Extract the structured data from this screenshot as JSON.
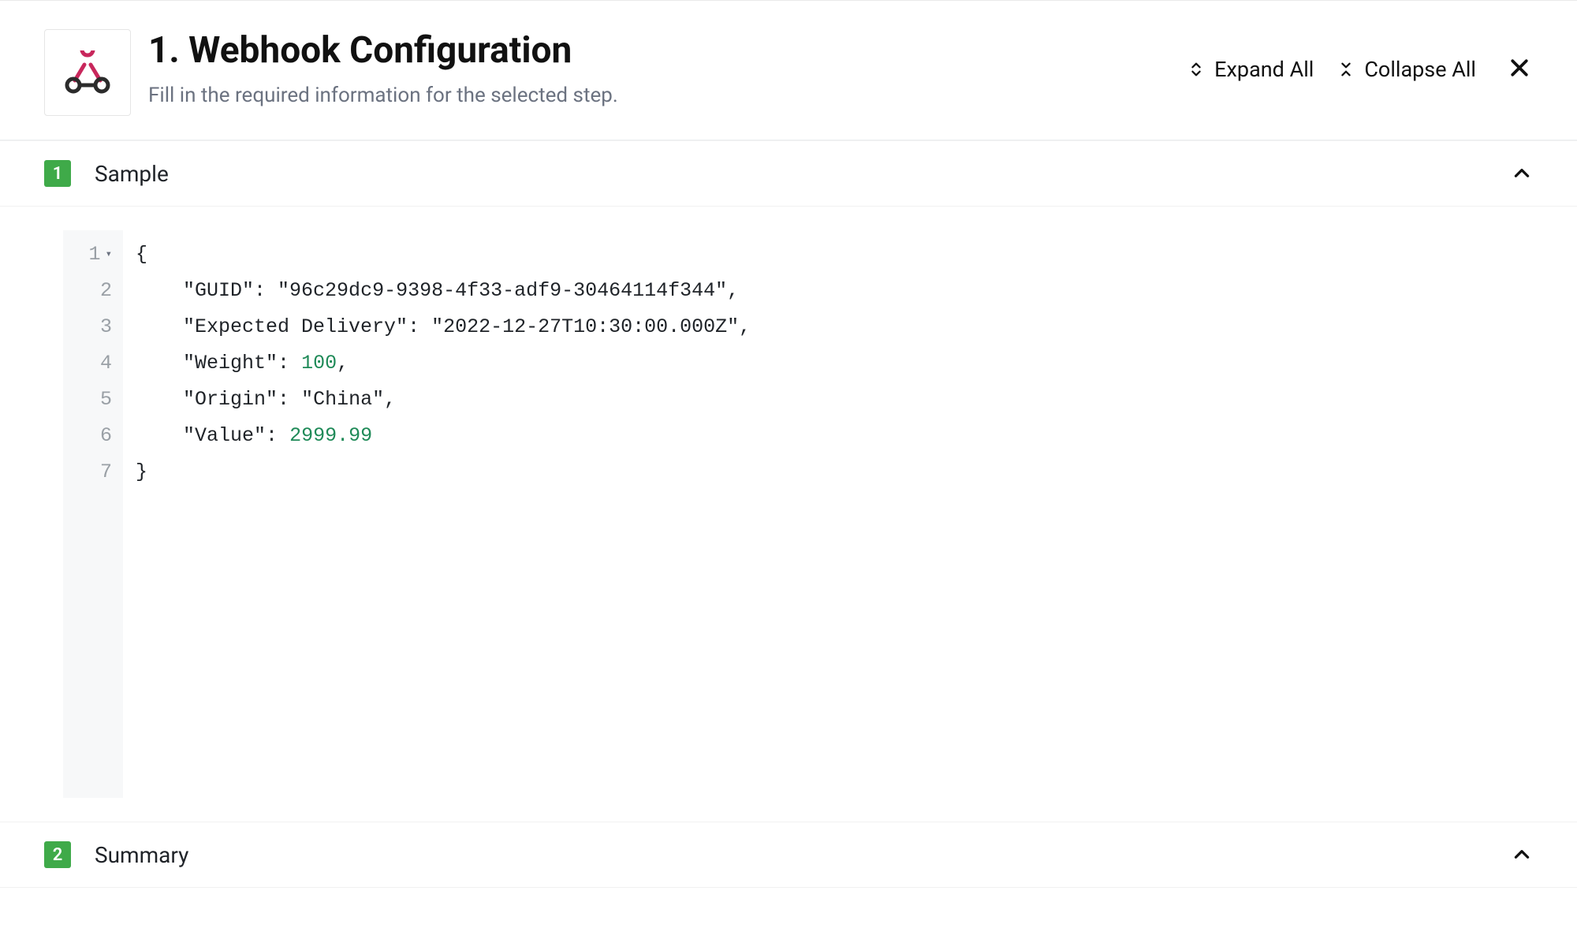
{
  "header": {
    "title": "1. Webhook Configuration",
    "subtitle": "Fill in the required information for the selected step.",
    "expand_label": "Expand All",
    "collapse_label": "Collapse All"
  },
  "sections": [
    {
      "num": "1",
      "title": "Sample"
    },
    {
      "num": "2",
      "title": "Summary"
    }
  ],
  "code_lines": [
    {
      "n": "1",
      "fold": true,
      "tokens": [
        {
          "t": "{",
          "cls": "punct"
        }
      ]
    },
    {
      "n": "2",
      "tokens": [
        {
          "t": "    ",
          "cls": "plain"
        },
        {
          "t": "\"GUID\"",
          "cls": "key"
        },
        {
          "t": ": ",
          "cls": "punct"
        },
        {
          "t": "\"96c29dc9-9398-4f33-adf9-30464114f344\"",
          "cls": "str"
        },
        {
          "t": ",",
          "cls": "punct"
        }
      ]
    },
    {
      "n": "3",
      "tokens": [
        {
          "t": "    ",
          "cls": "plain"
        },
        {
          "t": "\"Expected Delivery\"",
          "cls": "key"
        },
        {
          "t": ": ",
          "cls": "punct"
        },
        {
          "t": "\"2022-12-27T10:30:00.000Z\"",
          "cls": "str"
        },
        {
          "t": ",",
          "cls": "punct"
        }
      ]
    },
    {
      "n": "4",
      "tokens": [
        {
          "t": "    ",
          "cls": "plain"
        },
        {
          "t": "\"Weight\"",
          "cls": "key"
        },
        {
          "t": ": ",
          "cls": "punct"
        },
        {
          "t": "100",
          "cls": "num"
        },
        {
          "t": ",",
          "cls": "punct"
        }
      ]
    },
    {
      "n": "5",
      "tokens": [
        {
          "t": "    ",
          "cls": "plain"
        },
        {
          "t": "\"Origin\"",
          "cls": "key"
        },
        {
          "t": ": ",
          "cls": "punct"
        },
        {
          "t": "\"China\"",
          "cls": "str"
        },
        {
          "t": ",",
          "cls": "punct"
        }
      ]
    },
    {
      "n": "6",
      "tokens": [
        {
          "t": "    ",
          "cls": "plain"
        },
        {
          "t": "\"Value\"",
          "cls": "key"
        },
        {
          "t": ": ",
          "cls": "punct"
        },
        {
          "t": "2999.99",
          "cls": "num"
        }
      ]
    },
    {
      "n": "7",
      "tokens": [
        {
          "t": "}",
          "cls": "punct"
        }
      ]
    }
  ]
}
